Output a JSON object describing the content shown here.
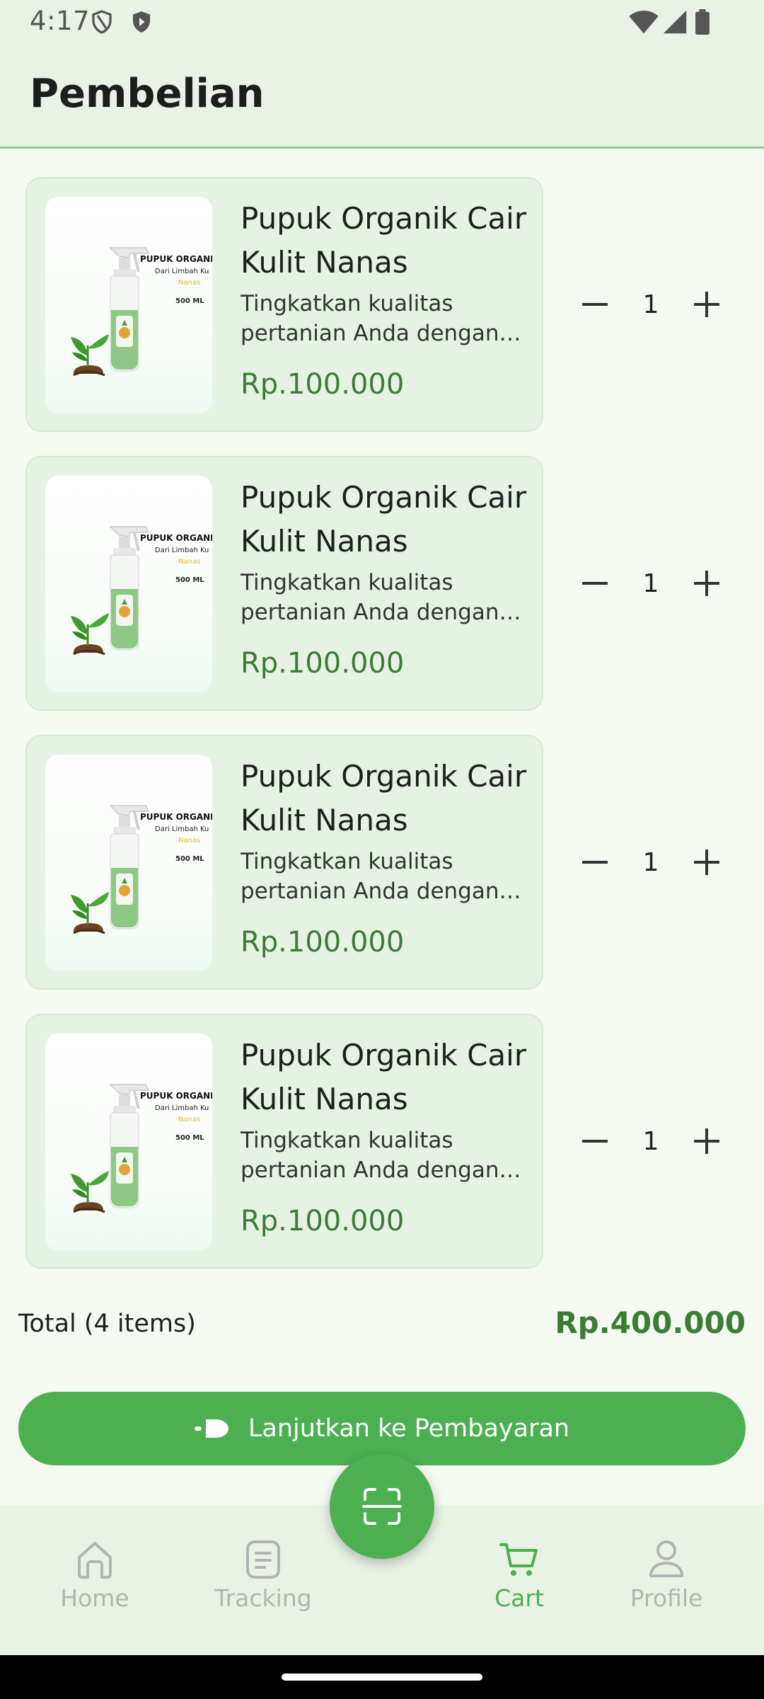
{
  "status_bar": {
    "time": "4:17"
  },
  "header": {
    "title": "Pembelian"
  },
  "cart": {
    "items": [
      {
        "name": "Pupuk Organik Cair Kulit Nanas",
        "description": "Tingkatkan kualitas pertanian Anda dengan ...",
        "price": "Rp.100.000",
        "quantity": "1"
      },
      {
        "name": "Pupuk Organik Cair Kulit Nanas",
        "description": "Tingkatkan kualitas pertanian Anda dengan ...",
        "price": "Rp.100.000",
        "quantity": "1"
      },
      {
        "name": "Pupuk Organik Cair Kulit Nanas",
        "description": "Tingkatkan kualitas pertanian Anda dengan ...",
        "price": "Rp.100.000",
        "quantity": "1"
      },
      {
        "name": "Pupuk Organik Cair Kulit Nanas",
        "description": "Tingkatkan kualitas pertanian Anda dengan ...",
        "price": "Rp.100.000",
        "quantity": "1"
      }
    ],
    "product_image_text": {
      "line1": "PUPUK ORGANIK",
      "line2": "Dari Limbah Ku",
      "line3": "Nanas",
      "line4": "500 ML"
    },
    "total_label": "Total (4 items)",
    "total_value": "Rp.400.000",
    "checkout_label": "Lanjutkan ke Pembayaran"
  },
  "bottom_nav": {
    "items": [
      {
        "label": "Home",
        "icon": "home-icon",
        "active": false
      },
      {
        "label": "Tracking",
        "icon": "document-icon",
        "active": false
      },
      {
        "label": "Cart",
        "icon": "cart-icon",
        "active": true
      },
      {
        "label": "Profile",
        "icon": "person-icon",
        "active": false
      }
    ],
    "scan_icon": "scan-icon"
  },
  "colors": {
    "accent": "#4caf50",
    "price": "#3b7d34",
    "card_bg": "#e6f3e4",
    "header_bg": "#e8f3e6"
  }
}
